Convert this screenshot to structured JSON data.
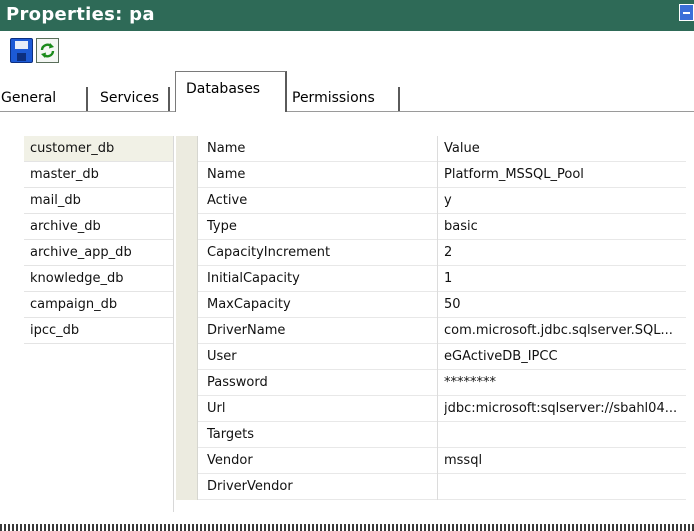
{
  "window": {
    "title": "Properties: pa"
  },
  "toolbar": {
    "save_icon": "save-icon",
    "refresh_icon": "refresh-icon"
  },
  "tabs": [
    {
      "label": "General"
    },
    {
      "label": "Services"
    },
    {
      "label": "Databases",
      "active": true
    },
    {
      "label": "Permissions"
    }
  ],
  "databases": [
    "customer_db",
    "master_db",
    "mail_db",
    "archive_db",
    "archive_app_db",
    "knowledge_db",
    "campaign_db",
    "ipcc_db"
  ],
  "properties": {
    "header": {
      "name": "Name",
      "value": "Value"
    },
    "rows": [
      {
        "name": "Name",
        "value": "Platform_MSSQL_Pool"
      },
      {
        "name": "Active",
        "value": "y"
      },
      {
        "name": "Type",
        "value": "basic"
      },
      {
        "name": "CapacityIncrement",
        "value": "2"
      },
      {
        "name": "InitialCapacity",
        "value": "1"
      },
      {
        "name": "MaxCapacity",
        "value": "50"
      },
      {
        "name": "DriverName",
        "value": "com.microsoft.jdbc.sqlserver.SQL..."
      },
      {
        "name": "User",
        "value": "eGActiveDB_IPCC"
      },
      {
        "name": "Password",
        "value": "********"
      },
      {
        "name": "Url",
        "value": "jdbc:microsoft:sqlserver://sbahl04..."
      },
      {
        "name": "Targets",
        "value": ""
      },
      {
        "name": "Vendor",
        "value": "mssql"
      },
      {
        "name": "DriverVendor",
        "value": ""
      }
    ]
  },
  "colors": {
    "titlebar": "#2e6a57",
    "selected_row": "#f1f1e6"
  }
}
